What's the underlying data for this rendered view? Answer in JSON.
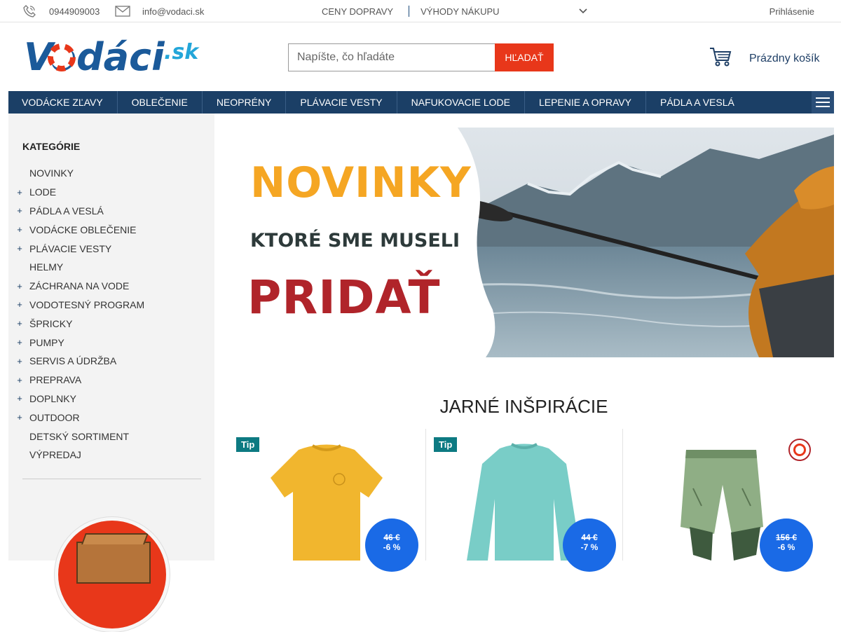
{
  "topbar": {
    "phone": "0944909003",
    "email": "info@vodaci.sk",
    "shipping_prices": "CENY DOPRAVY",
    "benefits": "VÝHODY NÁKUPU",
    "login": "Prihlásenie"
  },
  "header": {
    "logo_text": "Vodáci",
    "logo_suffix": ".sk",
    "search_placeholder": "Napíšte, čo hľadáte",
    "search_button": "HĽADAŤ",
    "cart_label": "Prázdny košík"
  },
  "nav": {
    "items": [
      "VODÁCKE ZĽAVY",
      "OBLEČENIE",
      "NEOPRÉNY",
      "PLÁVACIE VESTY",
      "NAFUKOVACIE LODE",
      "LEPENIE A OPRAVY",
      "PÁDLA A VESLÁ"
    ]
  },
  "sidebar": {
    "title": "KATEGÓRIE",
    "items": [
      {
        "label": "NOVINKY",
        "expandable": false
      },
      {
        "label": "LODE",
        "expandable": true
      },
      {
        "label": "PÁDLA A VESLÁ",
        "expandable": true
      },
      {
        "label": "VODÁCKE OBLEČENIE",
        "expandable": true
      },
      {
        "label": "PLÁVACIE VESTY",
        "expandable": true
      },
      {
        "label": "HELMY",
        "expandable": false
      },
      {
        "label": "ZÁCHRANA NA VODE",
        "expandable": true
      },
      {
        "label": "VODOTESNÝ PROGRAM",
        "expandable": true
      },
      {
        "label": "ŠPRICKY",
        "expandable": true
      },
      {
        "label": "PUMPY",
        "expandable": true
      },
      {
        "label": "SERVIS A ÚDRŽBA",
        "expandable": true
      },
      {
        "label": "PREPRAVA",
        "expandable": true
      },
      {
        "label": "DOPLNKY",
        "expandable": true
      },
      {
        "label": "OUTDOOR",
        "expandable": true
      },
      {
        "label": "DETSKÝ SORTIMENT",
        "expandable": false
      },
      {
        "label": "VÝPREDAJ",
        "expandable": false
      }
    ]
  },
  "banner": {
    "line1": "NOVINKY",
    "line2": "KTORÉ SME MUSELI",
    "line3": "PRIDAŤ"
  },
  "section": {
    "title": "JARNÉ INŠPIRÁCIE"
  },
  "products": [
    {
      "tag": "Tip",
      "old_price": "46 €",
      "discount": "-6 %",
      "image": "yellow-tshirt"
    },
    {
      "tag": "Tip",
      "old_price": "44 €",
      "discount": "-7 %",
      "image": "teal-longsleeve"
    },
    {
      "tag": "",
      "old_price": "156 €",
      "discount": "-6 %",
      "image": "green-shorts"
    }
  ],
  "colors": {
    "brand_blue": "#1b3f66",
    "accent_red": "#e8371a",
    "price_blue": "#1a6ae6",
    "tip_teal": "#0d7a82",
    "banner_yellow": "#f5a623",
    "banner_red": "#b0242a"
  }
}
